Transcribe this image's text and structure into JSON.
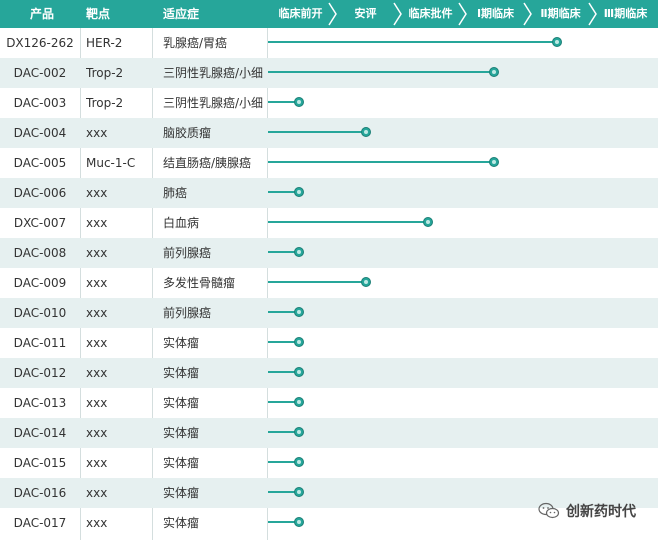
{
  "header": {
    "product": "产品",
    "target": "靶点",
    "indication": "适应症",
    "stages": [
      "临床前开",
      "安评",
      "临床批件",
      "Ⅰ期临床",
      "Ⅱ期临床",
      "Ⅲ期临床"
    ]
  },
  "rows": [
    {
      "product": "DX126-262",
      "target": "HER-2",
      "indication": "乳腺癌/胃癌",
      "progress": 0.74
    },
    {
      "product": "DAC-002",
      "target": "Trop-2",
      "indication": "三阴性乳腺癌/小细",
      "progress": 0.58
    },
    {
      "product": "DAC-003",
      "target": "Trop-2",
      "indication": "三阴性乳腺癌/小细",
      "progress": 0.08
    },
    {
      "product": "DAC-004",
      "target": "xxx",
      "indication": "脑胶质瘤",
      "progress": 0.25
    },
    {
      "product": "DAC-005",
      "target": "Muc-1-C",
      "indication": "结直肠癌/胰腺癌",
      "progress": 0.58
    },
    {
      "product": "DAC-006",
      "target": "xxx",
      "indication": "肺癌",
      "progress": 0.08
    },
    {
      "product": "DXC-007",
      "target": "xxx",
      "indication": "白血病",
      "progress": 0.41
    },
    {
      "product": "DAC-008",
      "target": "xxx",
      "indication": "前列腺癌",
      "progress": 0.08
    },
    {
      "product": "DAC-009",
      "target": "xxx",
      "indication": "多发性骨髓瘤",
      "progress": 0.25
    },
    {
      "product": "DAC-010",
      "target": "xxx",
      "indication": "前列腺癌",
      "progress": 0.08
    },
    {
      "product": "DAC-011",
      "target": "xxx",
      "indication": "实体瘤",
      "progress": 0.08
    },
    {
      "product": "DAC-012",
      "target": "xxx",
      "indication": "实体瘤",
      "progress": 0.08
    },
    {
      "product": "DAC-013",
      "target": "xxx",
      "indication": "实体瘤",
      "progress": 0.08
    },
    {
      "product": "DAC-014",
      "target": "xxx",
      "indication": "实体瘤",
      "progress": 0.08
    },
    {
      "product": "DAC-015",
      "target": "xxx",
      "indication": "实体瘤",
      "progress": 0.08
    },
    {
      "product": "DAC-016",
      "target": "xxx",
      "indication": "实体瘤",
      "progress": 0.08
    },
    {
      "product": "DAC-017",
      "target": "xxx",
      "indication": "实体瘤",
      "progress": 0.08
    }
  ],
  "watermark": {
    "text": "创新药时代",
    "icon": "wechat-icon"
  },
  "colors": {
    "header": "#26a69a",
    "accent": "#26a69a",
    "alt_row": "#e6f0f0"
  }
}
